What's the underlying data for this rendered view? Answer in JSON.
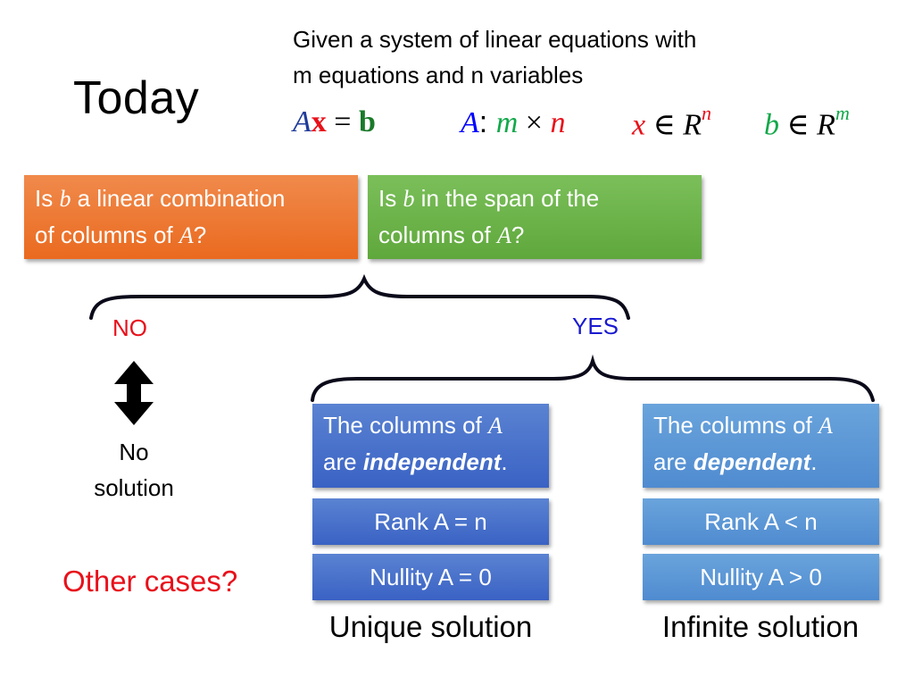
{
  "slide": {
    "title": "Today",
    "intro_line1": "Given a system of linear equations with",
    "intro_line2": "m equations and n variables",
    "equations": {
      "ax_eq_b": {
        "A": "A",
        "x": "x",
        "eq": " = ",
        "b": "b"
      },
      "dims": {
        "A": "A",
        "colon": ": ",
        "m": "m",
        "times": " × ",
        "n": "n"
      },
      "x_in": {
        "x": "x",
        "in": " ∈ ",
        "R": "R",
        "sup": "n"
      },
      "b_in": {
        "b": "b",
        "in": " ∈ ",
        "R": "R",
        "sup": "m"
      }
    },
    "question_left": {
      "pre": "Is ",
      "var": "b",
      "mid": " a linear combination",
      "line2": "of columns of ",
      "var2": "A",
      "end": "?"
    },
    "question_right": {
      "pre": "Is ",
      "var": "b",
      "mid": " in the span of the",
      "line2": "columns of ",
      "var2": "A",
      "end": "?"
    },
    "no_label": "NO",
    "yes_label": "YES",
    "no_solution": {
      "line1": "No",
      "line2": "solution"
    },
    "other_cases": "Other cases?",
    "left_column": {
      "statement_pre": "The columns of ",
      "statement_var": "A",
      "statement_line2_pre": "are ",
      "statement_emph": "independent",
      "statement_end": ".",
      "rank": "Rank A = n",
      "nullity": "Nullity A = 0",
      "result": "Unique solution"
    },
    "right_column": {
      "statement_pre": "The columns of ",
      "statement_var": "A",
      "statement_line2_pre": "are ",
      "statement_emph": "dependent",
      "statement_end": ".",
      "rank": "Rank A < n",
      "nullity": "Nullity A > 0",
      "result": "Infinite solution"
    },
    "colors": {
      "blue_math": "#1f3c99",
      "pure_blue": "#0000ff",
      "red": "#e8101a",
      "green_math": "#1a7a2a",
      "bright_green": "#12a84a",
      "orange_box": "#ee7530",
      "green_box": "#6cb24a",
      "dark_blue_box": "#4570cb",
      "light_blue_box": "#5b97d6"
    }
  }
}
